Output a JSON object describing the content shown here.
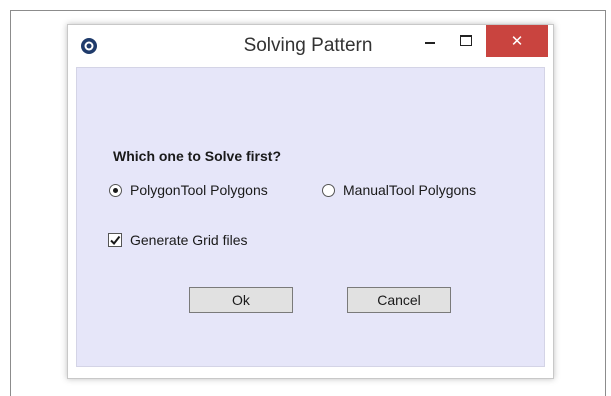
{
  "window": {
    "title": "Solving Pattern",
    "close_glyph": "✕"
  },
  "form": {
    "question": "Which one to Solve first?",
    "options": [
      {
        "label": "PolygonTool Polygons",
        "selected": true
      },
      {
        "label": "ManualTool Polygons",
        "selected": false
      }
    ],
    "generate_grid": {
      "label": "Generate Grid files",
      "checked": true
    }
  },
  "buttons": {
    "ok_label": "Ok",
    "cancel_label": "Cancel"
  },
  "colors": {
    "client_background": "#e6e6f9",
    "close_button": "#c9443f",
    "app_icon": "#1f3b6b"
  },
  "icons": {
    "app": "app-icon",
    "minimize": "minimize-icon",
    "maximize": "maximize-icon",
    "close": "close-icon",
    "check": "checkmark-icon"
  }
}
